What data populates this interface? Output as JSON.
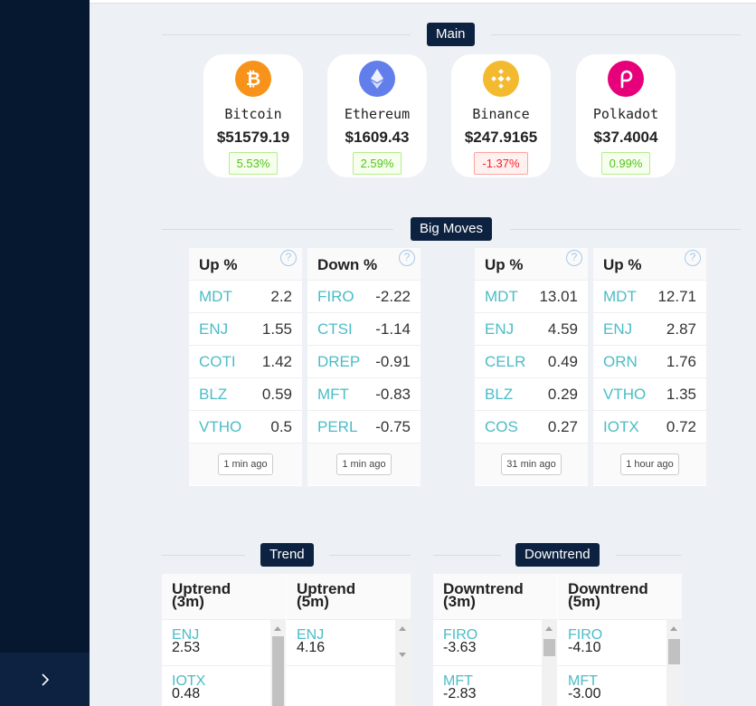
{
  "sidebar": {
    "toggle_icon": "chevron-right-icon"
  },
  "main_section": {
    "title": "Main",
    "coins": [
      {
        "name": "Bitcoin",
        "price": "$51579.19",
        "change": "5.53%",
        "direction": "up",
        "icon": "bitcoin-icon",
        "color": "#f7931a"
      },
      {
        "name": "Ethereum",
        "price": "$1609.43",
        "change": "2.59%",
        "direction": "up",
        "icon": "ethereum-icon",
        "color": "#627eea"
      },
      {
        "name": "Binance",
        "price": "$247.9165",
        "change": "-1.37%",
        "direction": "down",
        "icon": "binance-icon",
        "color": "#f3ba2f"
      },
      {
        "name": "Polkadot",
        "price": "$37.4004",
        "change": "0.99%",
        "direction": "up",
        "icon": "polkadot-icon",
        "color": "#e6007a"
      }
    ]
  },
  "big_moves": {
    "title": "Big Moves",
    "cards": [
      {
        "title": "Up %",
        "time": "1 min ago",
        "rows": [
          [
            "MDT",
            "2.2"
          ],
          [
            "ENJ",
            "1.55"
          ],
          [
            "COTI",
            "1.42"
          ],
          [
            "BLZ",
            "0.59"
          ],
          [
            "VTHO",
            "0.5"
          ]
        ]
      },
      {
        "title": "Down %",
        "time": "1 min ago",
        "rows": [
          [
            "FIRO",
            "-2.22"
          ],
          [
            "CTSI",
            "-1.14"
          ],
          [
            "DREP",
            "-0.91"
          ],
          [
            "MFT",
            "-0.83"
          ],
          [
            "PERL",
            "-0.75"
          ]
        ]
      },
      {
        "title": "Up %",
        "time": "31 min ago",
        "rows": [
          [
            "MDT",
            "13.01"
          ],
          [
            "ENJ",
            "4.59"
          ],
          [
            "CELR",
            "0.49"
          ],
          [
            "BLZ",
            "0.29"
          ],
          [
            "COS",
            "0.27"
          ]
        ]
      },
      {
        "title": "Up %",
        "time": "1 hour ago",
        "rows": [
          [
            "MDT",
            "12.71"
          ],
          [
            "ENJ",
            "2.87"
          ],
          [
            "ORN",
            "1.76"
          ],
          [
            "VTHO",
            "1.35"
          ],
          [
            "IOTX",
            "0.72"
          ]
        ]
      }
    ]
  },
  "trend": {
    "title": "Trend",
    "columns": [
      {
        "title_line1": "Uptrend",
        "title_line2": "(3m)",
        "items": [
          [
            "ENJ",
            "2.53"
          ],
          [
            "IOTX",
            "0.48"
          ]
        ]
      },
      {
        "title_line1": "Uptrend",
        "title_line2": "(5m)",
        "items": [
          [
            "ENJ",
            "4.16"
          ]
        ]
      }
    ]
  },
  "downtrend": {
    "title": "Downtrend",
    "columns": [
      {
        "title_line1": "Downtrend",
        "title_line2": "(3m)",
        "items": [
          [
            "FIRO",
            "-3.63"
          ],
          [
            "MFT",
            "-2.83"
          ]
        ]
      },
      {
        "title_line1": "Downtrend",
        "title_line2": "(5m)",
        "items": [
          [
            "FIRO",
            "-4.10"
          ],
          [
            "MFT",
            "-3.00"
          ]
        ]
      }
    ]
  },
  "colors": {
    "accent": "#0d2240",
    "sidebar": "#051830",
    "symbol": "#4cbcc6",
    "positive": "#52c41a",
    "negative": "#f5222d"
  }
}
